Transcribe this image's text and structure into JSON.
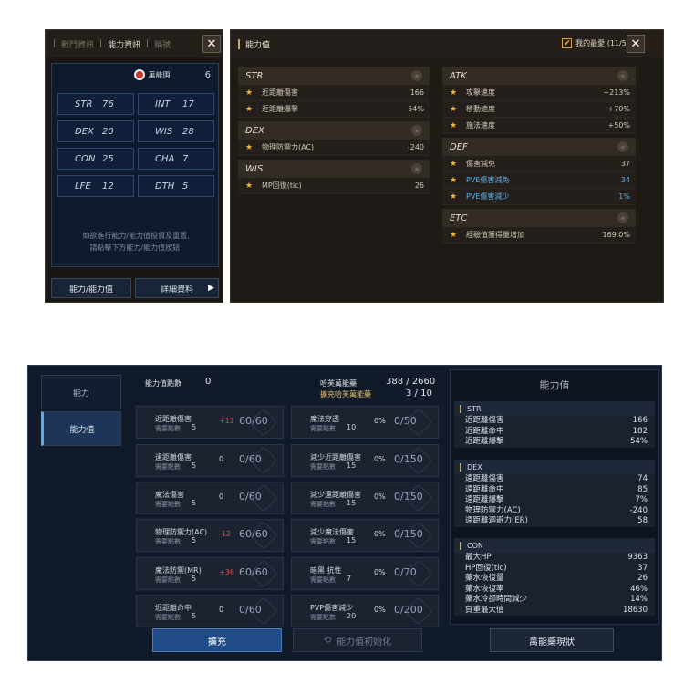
{
  "top_left": {
    "tabs": [
      "戰鬥資訊",
      "能力資訊",
      "稱號"
    ],
    "rank_label": "萬能園",
    "rank_value": "6",
    "stats": [
      {
        "k": "STR",
        "v": "76"
      },
      {
        "k": "INT",
        "v": "17"
      },
      {
        "k": "DEX",
        "v": "20"
      },
      {
        "k": "WIS",
        "v": "28"
      },
      {
        "k": "CON",
        "v": "25"
      },
      {
        "k": "CHA",
        "v": "7"
      },
      {
        "k": "LFE",
        "v": "12"
      },
      {
        "k": "DTH",
        "v": "5"
      }
    ],
    "hint1": "如欲進行能力/能力值投資及重置,",
    "hint2": "請點擊下方能力/能力值按鈕.",
    "btn_ability": "能力/能力值",
    "btn_detail": "詳細資料"
  },
  "top_right": {
    "title": "能力值",
    "favorite": "我的最愛 (11/50)",
    "left_groups": [
      {
        "name": "STR",
        "rows": [
          {
            "n": "近距離傷害",
            "v": "166"
          },
          {
            "n": "近距離爆擊",
            "v": "54%"
          }
        ]
      },
      {
        "name": "DEX",
        "rows": [
          {
            "n": "物理防禦力(AC)",
            "v": "-240"
          }
        ]
      },
      {
        "name": "WIS",
        "rows": [
          {
            "n": "MP回復(tic)",
            "v": "26"
          }
        ]
      }
    ],
    "right_groups": [
      {
        "name": "ATK",
        "rows": [
          {
            "n": "攻擊速度",
            "v": "+213%"
          },
          {
            "n": "移動速度",
            "v": "+70%"
          },
          {
            "n": "施法速度",
            "v": "+50%"
          }
        ]
      },
      {
        "name": "DEF",
        "rows": [
          {
            "n": "傷害減免",
            "v": "37"
          },
          {
            "n": "PVE傷害減免",
            "v": "34"
          },
          {
            "n": "PVE傷害減少",
            "v": "1%"
          }
        ]
      },
      {
        "name": "ETC",
        "rows": [
          {
            "n": "經驗值獲得量增加",
            "v": "169.0%"
          }
        ]
      }
    ]
  },
  "bottom": {
    "side_tabs": [
      "能力",
      "能力值"
    ],
    "points_label": "能力值點數",
    "points_value": "0",
    "potion_label": "哈芙萬能藥",
    "potion_value": "388 / 2660",
    "potion_fill_label": "擴充哈芙萬能藥",
    "potion_fill_value": "3 / 10",
    "need_label": "需要點數",
    "cards_left": [
      {
        "n": "近距離傷害",
        "need": "5",
        "d": "+12",
        "f": "60/60",
        "red": true
      },
      {
        "n": "遠距離傷害",
        "need": "5",
        "d": "0",
        "f": "0/60",
        "red": false
      },
      {
        "n": "魔法傷害",
        "need": "5",
        "d": "0",
        "f": "0/60",
        "red": false
      },
      {
        "n": "物理防禦力(AC)",
        "need": "5",
        "d": "-12",
        "f": "60/60",
        "red": true
      },
      {
        "n": "魔法防禦(MR)",
        "need": "5",
        "d": "+36",
        "f": "60/60",
        "red": true
      },
      {
        "n": "近距離命中",
        "need": "5",
        "d": "0",
        "f": "0/60",
        "red": false
      }
    ],
    "cards_right": [
      {
        "n": "魔法穿透",
        "need": "10",
        "d": "0%",
        "f": "0/50"
      },
      {
        "n": "減少近距離傷害",
        "need": "15",
        "d": "0%",
        "f": "0/150"
      },
      {
        "n": "減少遠距離傷害",
        "need": "15",
        "d": "0%",
        "f": "0/150"
      },
      {
        "n": "減少魔法傷害",
        "need": "15",
        "d": "0%",
        "f": "0/150"
      },
      {
        "n": "暗黑 抗性",
        "need": "7",
        "d": "0%",
        "f": "0/70"
      },
      {
        "n": "PVP傷害減少",
        "need": "20",
        "d": "0%",
        "f": "0/200"
      }
    ],
    "panel_title": "能力值",
    "str": {
      "name": "STR",
      "rows": [
        {
          "n": "近距離傷害",
          "v": "166"
        },
        {
          "n": "近距離命中",
          "v": "182"
        },
        {
          "n": "近距離爆擊",
          "v": "54%"
        }
      ]
    },
    "dex": {
      "name": "DEX",
      "rows": [
        {
          "n": "遠距離傷害",
          "v": "74"
        },
        {
          "n": "遠距離命中",
          "v": "85"
        },
        {
          "n": "遠距離爆擊",
          "v": "7%"
        },
        {
          "n": "物理防禦力(AC)",
          "v": "-240"
        },
        {
          "n": "遠距離迴避力(ER)",
          "v": "58"
        }
      ]
    },
    "con": {
      "name": "CON",
      "rows": [
        {
          "n": "最大HP",
          "v": "9363"
        },
        {
          "n": "HP回復(tic)",
          "v": "37"
        },
        {
          "n": "藥水恢復量",
          "v": "26"
        },
        {
          "n": "藥水恢復率",
          "v": "46%"
        },
        {
          "n": "藥水冷卻時間減少",
          "v": "14%"
        },
        {
          "n": "負重最大值",
          "v": "18630"
        }
      ]
    },
    "btn_expand": "擴充",
    "btn_reset": "能力值初始化",
    "btn_potion": "萬能藥現狀"
  },
  "colors": {
    "accent_gold": "#f0b43a",
    "negative_red": "#e0483f",
    "positive_blue": "#5fb0ea"
  }
}
